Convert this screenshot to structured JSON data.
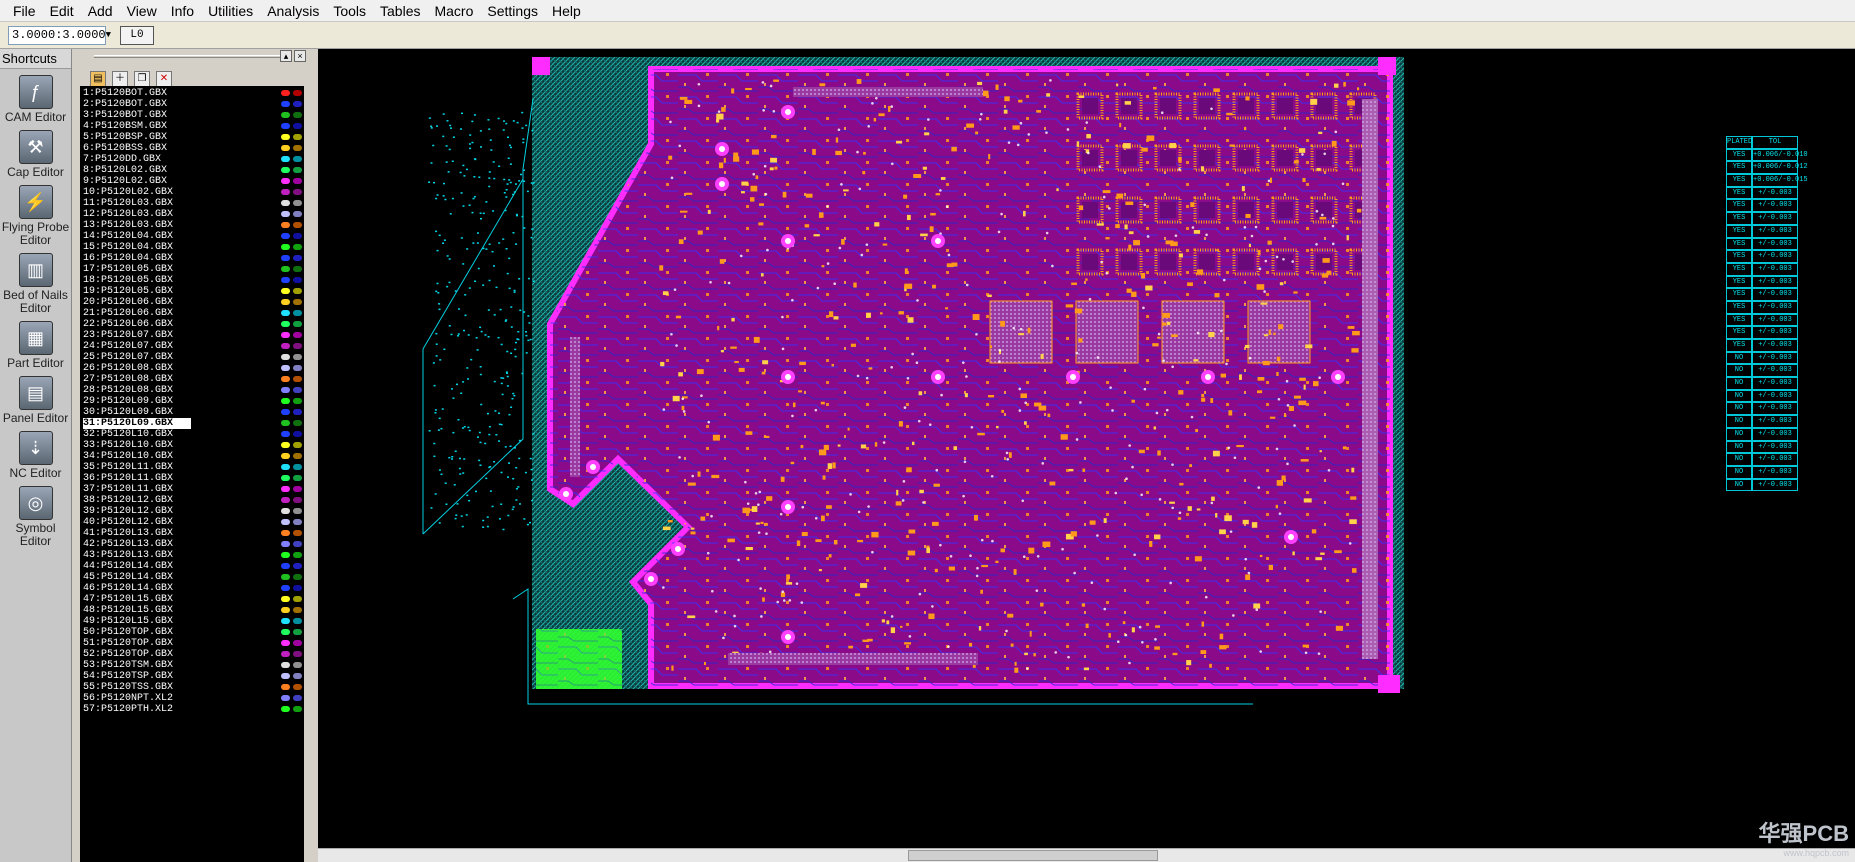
{
  "menu": [
    {
      "label": "File",
      "key": "F"
    },
    {
      "label": "Edit",
      "key": "E"
    },
    {
      "label": "Add",
      "key": "A"
    },
    {
      "label": "View",
      "key": "V"
    },
    {
      "label": "Info",
      "key": "I"
    },
    {
      "label": "Utilities",
      "key": "U"
    },
    {
      "label": "Analysis",
      "key": "n"
    },
    {
      "label": "Tools",
      "key": "o"
    },
    {
      "label": "Tables",
      "key": "T"
    },
    {
      "label": "Macro",
      "key": "M"
    },
    {
      "label": "Settings",
      "key": "S"
    },
    {
      "label": "Help",
      "key": "H"
    }
  ],
  "toolbar": {
    "scale_value": "3.0000:3.0000",
    "layer_button": "L0"
  },
  "shortcuts": {
    "header": "Shortcuts",
    "items": [
      {
        "label": "CAM Editor",
        "icon": "cam-editor-icon"
      },
      {
        "label": "Cap Editor",
        "icon": "cap-editor-icon"
      },
      {
        "label": "Flying Probe Editor",
        "icon": "flying-probe-icon"
      },
      {
        "label": "Bed of Nails Editor",
        "icon": "bed-of-nails-icon"
      },
      {
        "label": "Part Editor",
        "icon": "part-editor-icon"
      },
      {
        "label": "Panel Editor",
        "icon": "panel-editor-icon"
      },
      {
        "label": "NC Editor",
        "icon": "nc-editor-icon"
      },
      {
        "label": "Symbol Editor",
        "icon": "symbol-editor-icon"
      }
    ]
  },
  "layers": {
    "selected_index": 30,
    "items": [
      {
        "name": "1:P5120BOT.GBX",
        "c1": "#ff2020",
        "c2": "#b00000"
      },
      {
        "name": "2:P5120BOT.GBX",
        "c1": "#2040ff",
        "c2": "#2020c0"
      },
      {
        "name": "3:P5120BOT.GBX",
        "c1": "#20c020",
        "c2": "#107010"
      },
      {
        "name": "4:P5120BSM.GBX",
        "c1": "#2040ff",
        "c2": "#1010a0"
      },
      {
        "name": "5:P5120BSP.GBX",
        "c1": "#ffff20",
        "c2": "#a0a000"
      },
      {
        "name": "6:P5120BSS.GBX",
        "c1": "#ffd020",
        "c2": "#a07000"
      },
      {
        "name": "7:P5120DD.GBX",
        "c1": "#20e0ff",
        "c2": "#0090a0"
      },
      {
        "name": "8:P5120L02.GBX",
        "c1": "#20ff60",
        "c2": "#10a040"
      },
      {
        "name": "9:P5120L02.GBX",
        "c1": "#ff30ff",
        "c2": "#a000a0"
      },
      {
        "name": "10:P5120L02.GBX",
        "c1": "#c020c0",
        "c2": "#801080"
      },
      {
        "name": "11:P5120L03.GBX",
        "c1": "#e0e0e0",
        "c2": "#909090"
      },
      {
        "name": "12:P5120L03.GBX",
        "c1": "#c0c0ff",
        "c2": "#8080c0"
      },
      {
        "name": "13:P5120L03.GBX",
        "c1": "#ff8020",
        "c2": "#b05000"
      },
      {
        "name": "14:P5120L04.GBX",
        "c1": "#2040ff",
        "c2": "#1010a0"
      },
      {
        "name": "15:P5120L04.GBX",
        "c1": "#20ff20",
        "c2": "#10a010"
      },
      {
        "name": "16:P5120L04.GBX",
        "c1": "#2040ff",
        "c2": "#2020c0"
      },
      {
        "name": "17:P5120L05.GBX",
        "c1": "#20c020",
        "c2": "#107010"
      },
      {
        "name": "18:P5120L05.GBX",
        "c1": "#2040ff",
        "c2": "#1010a0"
      },
      {
        "name": "19:P5120L05.GBX",
        "c1": "#ffff20",
        "c2": "#a0a000"
      },
      {
        "name": "20:P5120L06.GBX",
        "c1": "#ffd020",
        "c2": "#a07000"
      },
      {
        "name": "21:P5120L06.GBX",
        "c1": "#20e0ff",
        "c2": "#0090a0"
      },
      {
        "name": "22:P5120L06.GBX",
        "c1": "#20ff60",
        "c2": "#10a040"
      },
      {
        "name": "23:P5120L07.GBX",
        "c1": "#ff30ff",
        "c2": "#a000a0"
      },
      {
        "name": "24:P5120L07.GBX",
        "c1": "#c020c0",
        "c2": "#801080"
      },
      {
        "name": "25:P5120L07.GBX",
        "c1": "#e0e0e0",
        "c2": "#909090"
      },
      {
        "name": "26:P5120L08.GBX",
        "c1": "#c0c0ff",
        "c2": "#8080c0"
      },
      {
        "name": "27:P5120L08.GBX",
        "c1": "#ff8020",
        "c2": "#b05000"
      },
      {
        "name": "28:P5120L08.GBX",
        "c1": "#8080ff",
        "c2": "#4040c0"
      },
      {
        "name": "29:P5120L09.GBX",
        "c1": "#20ff20",
        "c2": "#10a010"
      },
      {
        "name": "30:P5120L09.GBX",
        "c1": "#2040ff",
        "c2": "#2020c0"
      },
      {
        "name": "31:P5120L09.GBX",
        "c1": "#20c020",
        "c2": "#107010"
      },
      {
        "name": "32:P5120L10.GBX",
        "c1": "#2040ff",
        "c2": "#1010a0"
      },
      {
        "name": "33:P5120L10.GBX",
        "c1": "#ffff20",
        "c2": "#a0a000"
      },
      {
        "name": "34:P5120L10.GBX",
        "c1": "#ffd020",
        "c2": "#a07000"
      },
      {
        "name": "35:P5120L11.GBX",
        "c1": "#20e0ff",
        "c2": "#0090a0"
      },
      {
        "name": "36:P5120L11.GBX",
        "c1": "#20ff60",
        "c2": "#10a040"
      },
      {
        "name": "37:P5120L11.GBX",
        "c1": "#ff30ff",
        "c2": "#a000a0"
      },
      {
        "name": "38:P5120L12.GBX",
        "c1": "#c020c0",
        "c2": "#801080"
      },
      {
        "name": "39:P5120L12.GBX",
        "c1": "#e0e0e0",
        "c2": "#909090"
      },
      {
        "name": "40:P5120L12.GBX",
        "c1": "#c0c0ff",
        "c2": "#8080c0"
      },
      {
        "name": "41:P5120L13.GBX",
        "c1": "#ff8020",
        "c2": "#b05000"
      },
      {
        "name": "42:P5120L13.GBX",
        "c1": "#8080ff",
        "c2": "#4040c0"
      },
      {
        "name": "43:P5120L13.GBX",
        "c1": "#20ff20",
        "c2": "#10a010"
      },
      {
        "name": "44:P5120L14.GBX",
        "c1": "#2040ff",
        "c2": "#2020c0"
      },
      {
        "name": "45:P5120L14.GBX",
        "c1": "#20c020",
        "c2": "#107010"
      },
      {
        "name": "46:P5120L14.GBX",
        "c1": "#2040ff",
        "c2": "#1010a0"
      },
      {
        "name": "47:P5120L15.GBX",
        "c1": "#ffff20",
        "c2": "#a0a000"
      },
      {
        "name": "48:P5120L15.GBX",
        "c1": "#ffd020",
        "c2": "#a07000"
      },
      {
        "name": "49:P5120L15.GBX",
        "c1": "#20e0ff",
        "c2": "#0090a0"
      },
      {
        "name": "50:P5120TOP.GBX",
        "c1": "#20ff60",
        "c2": "#10a040"
      },
      {
        "name": "51:P5120TOP.GBX",
        "c1": "#ff30ff",
        "c2": "#a000a0"
      },
      {
        "name": "52:P5120TOP.GBX",
        "c1": "#c020c0",
        "c2": "#801080"
      },
      {
        "name": "53:P5120TSM.GBX",
        "c1": "#e0e0e0",
        "c2": "#909090"
      },
      {
        "name": "54:P5120TSP.GBX",
        "c1": "#c0c0ff",
        "c2": "#8080c0"
      },
      {
        "name": "55:P5120TSS.GBX",
        "c1": "#ff8020",
        "c2": "#b05000"
      },
      {
        "name": "56:P5120NPT.XL2",
        "c1": "#8080ff",
        "c2": "#4040c0"
      },
      {
        "name": "57:P5120PTH.XL2",
        "c1": "#20ff20",
        "c2": "#10a010"
      }
    ]
  },
  "fab_table": {
    "header": [
      "PLATED",
      "TOL"
    ],
    "rows": [
      [
        "YES",
        "+0.006/-0.010"
      ],
      [
        "YES",
        "+0.006/-0.012"
      ],
      [
        "YES",
        "+0.006/-0.015"
      ],
      [
        "YES",
        "+/-0.003"
      ],
      [
        "YES",
        "+/-0.003"
      ],
      [
        "YES",
        "+/-0.003"
      ],
      [
        "YES",
        "+/-0.003"
      ],
      [
        "YES",
        "+/-0.003"
      ],
      [
        "YES",
        "+/-0.003"
      ],
      [
        "YES",
        "+/-0.003"
      ],
      [
        "YES",
        "+/-0.003"
      ],
      [
        "YES",
        "+/-0.003"
      ],
      [
        "YES",
        "+/-0.003"
      ],
      [
        "YES",
        "+/-0.003"
      ],
      [
        "YES",
        "+/-0.003"
      ],
      [
        "YES",
        "+/-0.003"
      ],
      [
        "NO",
        "+/-0.003"
      ],
      [
        "NO",
        "+/-0.003"
      ],
      [
        "NO",
        "+/-0.003"
      ],
      [
        "NO",
        "+/-0.003"
      ],
      [
        "NO",
        "+/-0.003"
      ],
      [
        "NO",
        "+/-0.003"
      ],
      [
        "NO",
        "+/-0.003"
      ],
      [
        "NO",
        "+/-0.003"
      ],
      [
        "NO",
        "+/-0.003"
      ],
      [
        "NO",
        "+/-0.003"
      ],
      [
        "NO",
        "+/-0.003"
      ]
    ]
  },
  "watermark": {
    "main": "华强PCB",
    "sub": "www.hqpcb.com"
  },
  "colors": {
    "board": "#8a0a8a",
    "outline": "#ff2cff",
    "hatch": "#1fb5b0",
    "traces": "#3030ff",
    "pads": "#ff9a1a",
    "green_layer": "#30ff30"
  }
}
